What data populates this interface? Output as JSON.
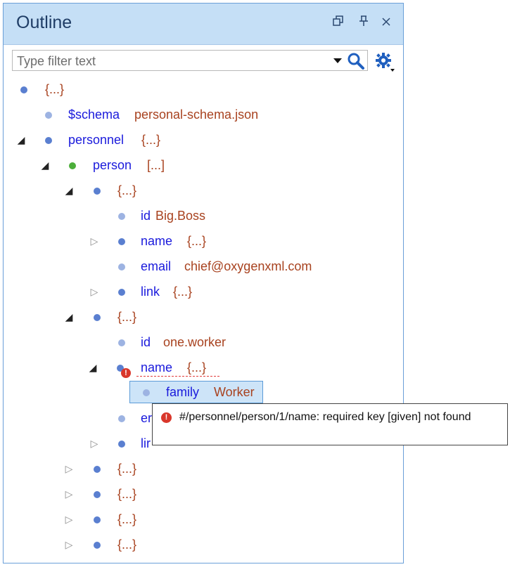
{
  "panel": {
    "title": "Outline",
    "restore_icon": "restore-window-icon",
    "pin_icon": "pin-icon",
    "close_icon": "close-icon"
  },
  "filter": {
    "placeholder": "Type filter text",
    "value": "",
    "dropdown_icon": "dropdown-arrow-icon",
    "search_icon": "search-icon",
    "settings_icon": "gear-icon"
  },
  "tree": [
    {
      "key": "",
      "value": "{...}"
    },
    {
      "key": "$schema",
      "value": "personal-schema.json"
    },
    {
      "key": "personnel",
      "value": "{...}"
    },
    {
      "key": "person",
      "value": "[...]"
    },
    {
      "key": "",
      "value": "{...}"
    },
    {
      "key": "id",
      "value": "Big.Boss"
    },
    {
      "key": "name",
      "value": "{...}"
    },
    {
      "key": "email",
      "value": "chief@oxygenxml.com"
    },
    {
      "key": "link",
      "value": "{...}"
    },
    {
      "key": "",
      "value": "{...}"
    },
    {
      "key": "id",
      "value": "one.worker"
    },
    {
      "key": "name",
      "value": "{...}"
    },
    {
      "key": "family",
      "value": "Worker"
    },
    {
      "key": "er",
      "value": ""
    },
    {
      "key": "lir",
      "value": ""
    },
    {
      "key": "",
      "value": "{...}"
    },
    {
      "key": "",
      "value": "{...}"
    },
    {
      "key": "",
      "value": "{...}"
    },
    {
      "key": "",
      "value": "{...}"
    }
  ],
  "tooltip": {
    "message": "#/personnel/person/1/name: required key [given] not found",
    "icon": "error-icon"
  },
  "colors": {
    "key": "#1a1adc",
    "value": "#a8421f",
    "selection": "#cde4f8",
    "error": "#d9372b"
  }
}
